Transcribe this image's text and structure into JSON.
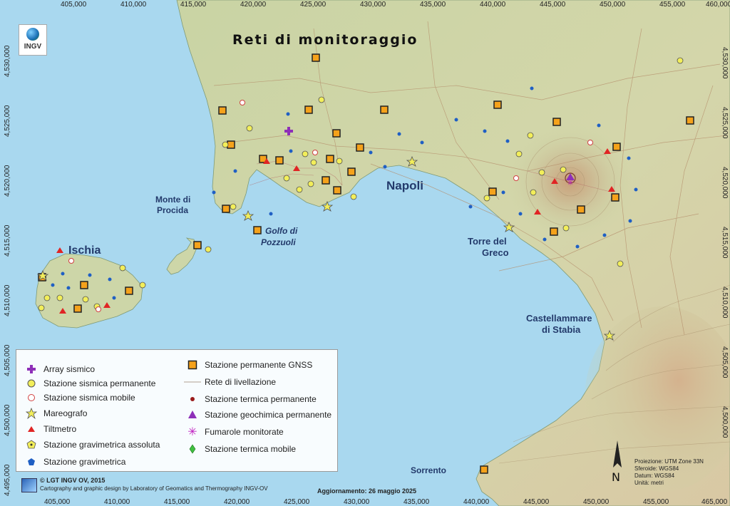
{
  "title": "Reti di monitoraggio",
  "logo": {
    "text": "INGV",
    "icon": "globe-icon"
  },
  "x_ticks": [
    "405,000",
    "410,000",
    "415,000",
    "420,000",
    "425,000",
    "430,000",
    "435,000",
    "440,000",
    "445,000",
    "450,000",
    "455,000",
    "460,000",
    "465,000"
  ],
  "y_ticks": [
    "4,530,000",
    "4,525,000",
    "4,520,000",
    "4,515,000",
    "4,510,000",
    "4,505,000",
    "4,500,000",
    "4,495,000"
  ],
  "places": {
    "napoli": "Napoli",
    "ischia": "Ischia",
    "monte_procida_1": "Monte di",
    "monte_procida_2": "Procida",
    "golfo_1": "Golfo di",
    "golfo_2": "Pozzuoli",
    "torre_1": "Torre del",
    "torre_2": "Greco",
    "castell_1": "Castellammare",
    "castell_2": "di Stabia",
    "sorrento": "Sorrento"
  },
  "legend": {
    "left": [
      {
        "icon": "purple-cross-icon",
        "label": "Array sismico"
      },
      {
        "icon": "yellow-circle-icon",
        "label": "Stazione sismica permanente"
      },
      {
        "icon": "open-red-circle-icon",
        "label": "Stazione sismica mobile"
      },
      {
        "icon": "yellow-star-icon",
        "label": "Mareografo"
      },
      {
        "icon": "red-triangle-icon",
        "label": "Tiltmetro"
      },
      {
        "icon": "yellow-pentagon-icon",
        "label": "Stazione gravimetrica assoluta"
      },
      {
        "icon": "blue-pentagon-icon",
        "label": "Stazione gravimetrica"
      }
    ],
    "right": [
      {
        "icon": "orange-square-icon",
        "label": "Stazione permanente GNSS"
      },
      {
        "icon": "line-icon",
        "label": "Rete di livellazione"
      },
      {
        "icon": "dark-red-dot-icon",
        "label": "Stazione termica permanente"
      },
      {
        "icon": "purple-triangle-icon",
        "label": "Stazione geochimica permanente"
      },
      {
        "icon": "magenta-asterisk-icon",
        "label": "Fumarole monitorate"
      },
      {
        "icon": "green-diamond-icon",
        "label": "Stazione termica mobile"
      }
    ]
  },
  "credits": {
    "line1": "© LGT INGV OV, 2015",
    "line2": "Cartography and graphic design by Laboratory of Geomatics and Thermography INGV-OV"
  },
  "update": "Aggiornamento: 26 maggio 2025",
  "projection": [
    "Proiezione: UTM Zone 33N",
    "Sferoide: WGS84",
    "Datum: WGS84",
    "Unità: metri"
  ],
  "north": "N",
  "colors": {
    "sea": "#a9d8ef",
    "land": "#cdd6a8",
    "gnss": "#f5a21b",
    "seismic": "#f2ee5a",
    "tilt": "#e02424",
    "array": "#8e2fb8"
  }
}
